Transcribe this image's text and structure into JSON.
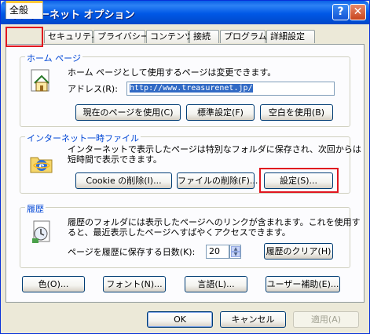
{
  "window": {
    "title": "インターネット オプション",
    "help_label": "?",
    "close_label": "✕"
  },
  "tabs": [
    {
      "label": "全般"
    },
    {
      "label": "セキュリティ"
    },
    {
      "label": "プライバシー"
    },
    {
      "label": "コンテンツ"
    },
    {
      "label": "接続"
    },
    {
      "label": "プログラム"
    },
    {
      "label": "詳細設定"
    }
  ],
  "home_page": {
    "legend": "ホーム ページ",
    "description": "ホーム ページとして使用するページは変更できます。",
    "address_label": "アドレス(R):",
    "address_value": "http://www.treasurenet.jp/",
    "buttons": [
      "現在のページを使用(C)",
      "標準設定(F)",
      "空白を使用(B)"
    ]
  },
  "temp_files": {
    "legend": "インターネット一時ファイル",
    "description_line1": "インターネットで表示したページは特別なフォルダに保存され、次回からは",
    "description_line2": "短時間で表示できます。",
    "buttons": [
      "Cookie の削除(I)...",
      "ファイルの削除(F)...",
      "設定(S)..."
    ]
  },
  "history": {
    "legend": "履歴",
    "description_line1": "履歴のフォルダには表示したページへのリンクが含まれます。これを使用す",
    "description_line2": "ると、最近表示したページへすばやくアクセスできます。",
    "days_label": "ページを履歴に保存する日数(K):",
    "days_value": "20",
    "clear_button": "履歴のクリア(H)"
  },
  "bottom_buttons": [
    "色(O)...",
    "フォント(N)...",
    "言語(L)...",
    "ユーザー補助(E)..."
  ],
  "dialog_buttons": {
    "ok": "OK",
    "cancel": "キャンセル",
    "apply": "適用(A)"
  },
  "colors": {
    "title_bar": "#0058e6",
    "legend_text": "#0046d5",
    "highlight": "#e0161f",
    "tab_accent": "#ffc83c"
  }
}
